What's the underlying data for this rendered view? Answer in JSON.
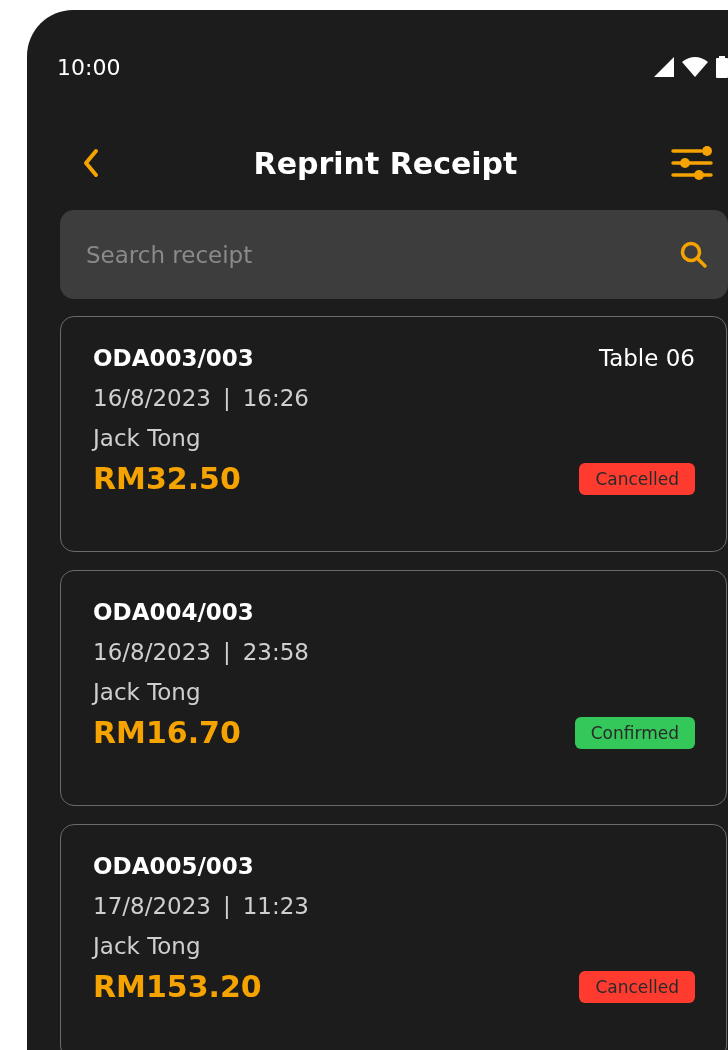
{
  "status_bar": {
    "time": "10:00"
  },
  "header": {
    "title": "Reprint Receipt"
  },
  "search": {
    "placeholder": "Search receipt"
  },
  "receipts": [
    {
      "order_no": "ODA003/003",
      "table": "Table 06",
      "date": "16/8/2023",
      "separator": "|",
      "time": "16:26",
      "customer": "Jack Tong",
      "amount": "RM32.50",
      "status": {
        "label": "Cancelled",
        "color": "#ff3b30"
      }
    },
    {
      "order_no": "ODA004/003",
      "date": "16/8/2023",
      "separator": "|",
      "time": "23:58",
      "customer": "Jack Tong",
      "amount": "RM16.70",
      "status": {
        "label": "Confirmed",
        "color": "#34c759"
      }
    },
    {
      "order_no": "ODA005/003",
      "date": "17/8/2023",
      "separator": "|",
      "time": "11:23",
      "customer": "Jack Tong",
      "amount": "RM153.20",
      "status": {
        "label": "Cancelled",
        "color": "#ff3b30"
      }
    }
  ]
}
